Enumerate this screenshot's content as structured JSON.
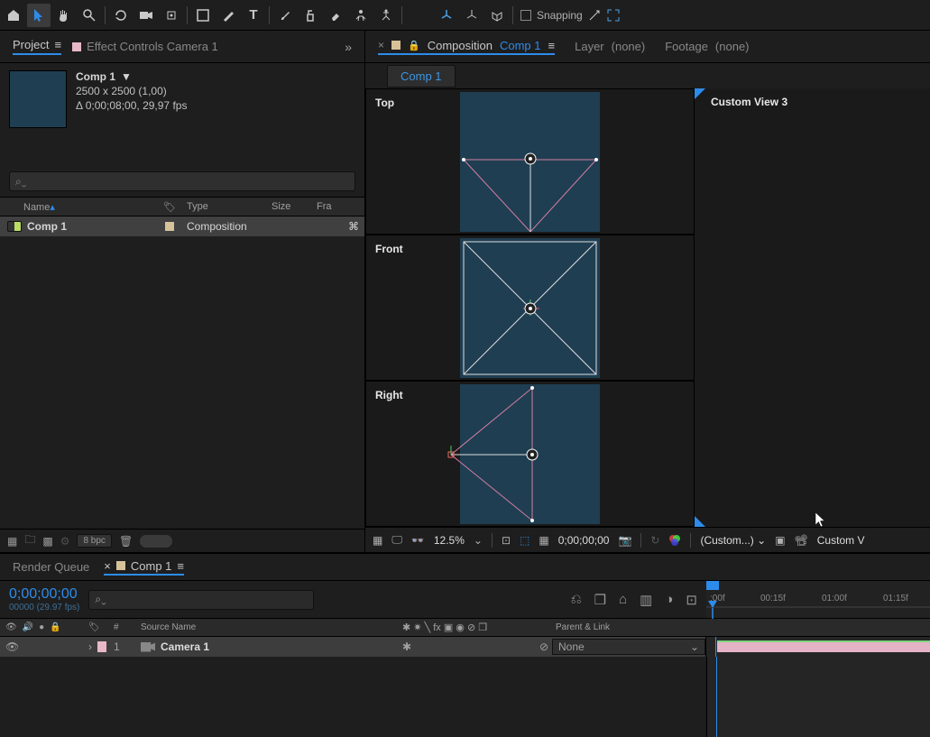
{
  "toolbar": {
    "snapping_label": "Snapping"
  },
  "project_panel": {
    "tab_project": "Project",
    "tab_effect_controls": "Effect Controls Camera 1",
    "comp_name": "Comp 1",
    "dimensions": "2500 x 2500 (1,00)",
    "duration": "Δ 0;00;08;00, 29,97 fps",
    "columns": {
      "name": "Name",
      "type": "Type",
      "size": "Size",
      "fr": "Fra"
    },
    "rows": [
      {
        "name": "Comp 1",
        "type": "Composition"
      }
    ],
    "bpc": "8 bpc"
  },
  "comp_panel": {
    "tab_comp_label": "Composition",
    "comp_name": "Comp 1",
    "tab_layer": "Layer",
    "tab_layer_none": "(none)",
    "tab_footage": "Footage",
    "tab_footage_none": "(none)",
    "sub_tab": "Comp 1",
    "views": {
      "top": "Top",
      "front": "Front",
      "right": "Right",
      "custom": "Custom View 3"
    },
    "footer": {
      "zoom": "12.5%",
      "time": "0;00;00;00",
      "view_label": "(Custom...)",
      "right_label": "Custom V"
    }
  },
  "timeline": {
    "tab_render": "Render Queue",
    "tab_comp": "Comp 1",
    "timecode": "0;00;00;00",
    "timecode_sub": "00000 (29.97 fps)",
    "columns": {
      "hash": "#",
      "source": "Source Name",
      "parent": "Parent & Link"
    },
    "ruler": [
      ":00f",
      "00:15f",
      "01:00f",
      "01:15f"
    ],
    "rows": [
      {
        "num": "1",
        "name": "Camera 1",
        "parent": "None"
      }
    ]
  }
}
